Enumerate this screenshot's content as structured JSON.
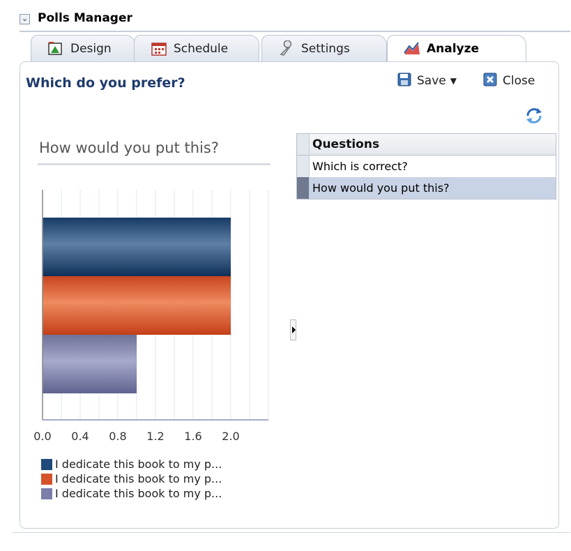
{
  "header": {
    "title": "Polls Manager"
  },
  "tabs": [
    {
      "label": "Design",
      "icon": "design-icon"
    },
    {
      "label": "Schedule",
      "icon": "calendar-icon"
    },
    {
      "label": "Settings",
      "icon": "wrench-icon"
    },
    {
      "label": "Analyze",
      "icon": "chart-icon",
      "active": true
    }
  ],
  "poll": {
    "title": "Which do you prefer?"
  },
  "toolbar": {
    "save_label": "Save",
    "close_label": "Close"
  },
  "questions_table": {
    "header": "Questions",
    "rows": [
      "Which is correct?",
      "How would you put this?"
    ],
    "selected_index": 1
  },
  "chart_data": {
    "type": "bar",
    "orientation": "horizontal",
    "title": "How would you put this?",
    "xlim": [
      0,
      2.4
    ],
    "x_ticks": [
      "0.0",
      "0.4",
      "0.8",
      "1.2",
      "1.6",
      "2.0"
    ],
    "grid": true,
    "legend_position": "bottom",
    "series": [
      {
        "name": "I dedicate this book to my p...",
        "value": 2.0,
        "color": "#1e4a7a"
      },
      {
        "name": "I dedicate this book to my p...",
        "value": 2.0,
        "color": "#d4532a"
      },
      {
        "name": "I dedicate this book to my p...",
        "value": 1.0,
        "color": "#7a7ea8"
      }
    ]
  }
}
